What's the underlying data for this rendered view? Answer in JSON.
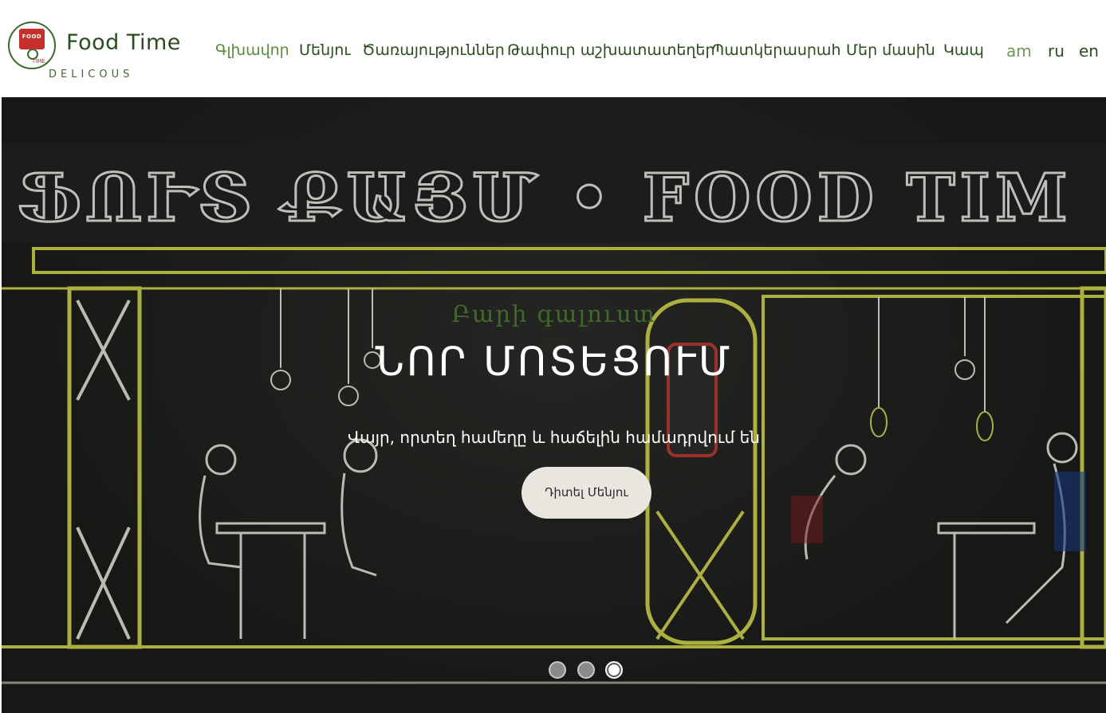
{
  "brand": {
    "name": "Food Time",
    "tagline": "DELICOUS",
    "logo_text": "FOOD",
    "logo_subtext": "TIME"
  },
  "nav": {
    "items": [
      {
        "label": "Գլխավոր",
        "active": true
      },
      {
        "label": "Մենյու",
        "active": false
      },
      {
        "label": "Ծառայություններ",
        "active": false
      },
      {
        "label": "Թափուր աշխատատեղեր",
        "active": false
      },
      {
        "label": "Պատկերասրահ",
        "active": false
      },
      {
        "label": "Մեր մասին",
        "active": false
      },
      {
        "label": "Կապ",
        "active": false
      }
    ]
  },
  "languages": [
    {
      "label": "am",
      "active": true
    },
    {
      "label": "ru",
      "active": false
    },
    {
      "label": "en",
      "active": false
    }
  ],
  "hero": {
    "subtitle": "Բարի գալուստ",
    "title": "ՆՈՐ ՄՈՏԵՑՈՒՄ",
    "description": "Վայր, որտեղ համեղը և հաճելին համադրվում են",
    "button_label": "Դիտել Մենյու",
    "chalk_sign": "ՖՈՒՏ ՔԱՅՄ • FOOD TIM"
  },
  "slider": {
    "total": 3,
    "active_index": 3
  },
  "colors": {
    "brand_green": "#2a4d1e",
    "active_nav": "#5b8a3a",
    "logo_red": "#c62f2b",
    "chalk_yellow": "#c9cf4a"
  }
}
